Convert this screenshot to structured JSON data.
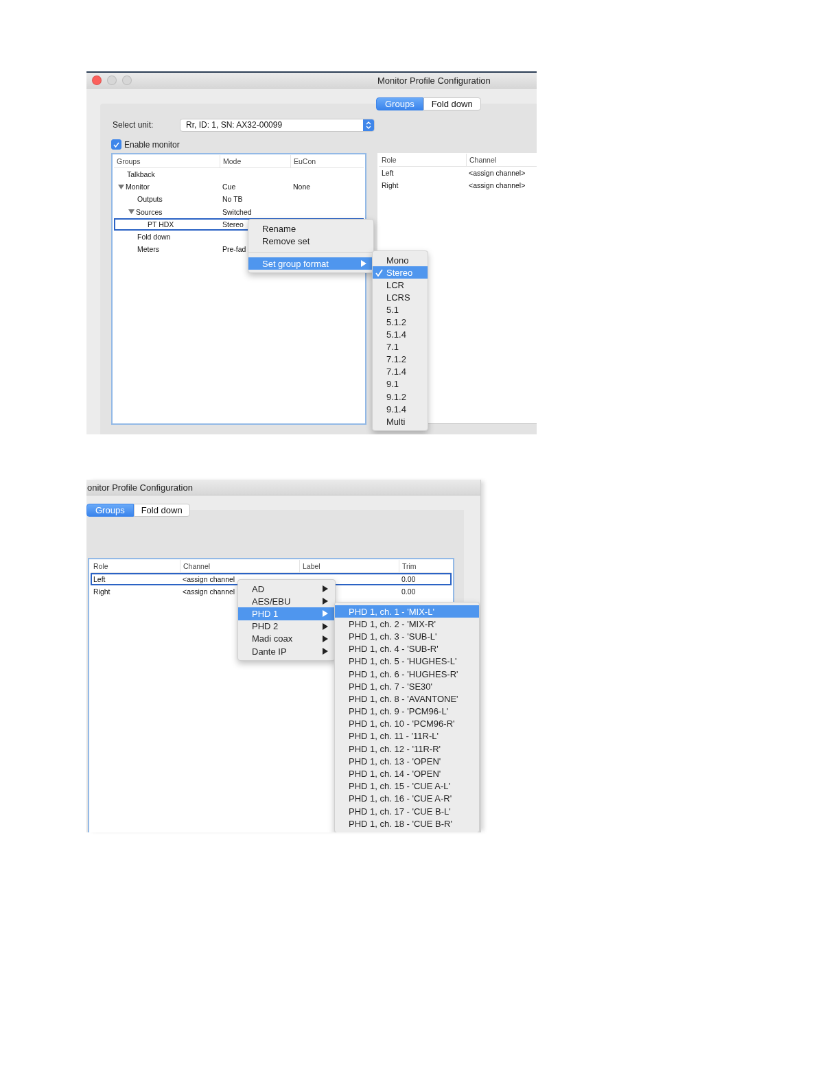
{
  "window_1": {
    "title": "Monitor Profile Configuration",
    "tabs": [
      {
        "label": "Groups",
        "selected": true
      },
      {
        "label": "Fold down",
        "selected": false
      }
    ],
    "select_unit": {
      "label": "Select unit:",
      "value": "Rr, ID: 1, SN: AX32-00099"
    },
    "enable_monitor": {
      "label": "Enable monitor",
      "checked": true
    },
    "groups_table": {
      "columns": [
        "Groups",
        "Mode",
        "EuCon"
      ],
      "rows": [
        {
          "name": "Talkback",
          "selected": false
        },
        {
          "name": "Monitor",
          "mode": "Cue",
          "eucon": "None",
          "expanded": true,
          "selected": false,
          "children": [
            {
              "name": "Outputs",
              "mode": "No TB",
              "selected": false
            },
            {
              "name": "Sources",
              "mode": "Switched",
              "expanded": true,
              "selected": false,
              "children": [
                {
                  "name": "PT HDX",
                  "mode": "Stereo",
                  "selected": true
                }
              ]
            },
            {
              "name": "Fold down",
              "selected": false
            },
            {
              "name": "Meters",
              "mode": "Pre-fad",
              "selected": false
            }
          ]
        }
      ]
    },
    "roles_table": {
      "columns": [
        "Role",
        "Channel"
      ],
      "rows": [
        {
          "role": "Left",
          "channel": "<assign channel>"
        },
        {
          "role": "Right",
          "channel": "<assign channel>"
        }
      ]
    },
    "context_menu": {
      "items": [
        {
          "kind": "item",
          "label": "Rename",
          "highlighted": false,
          "submenu": false
        },
        {
          "kind": "item",
          "label": "Remove set",
          "highlighted": false,
          "submenu": false
        },
        {
          "kind": "separator"
        },
        {
          "kind": "item",
          "label": "Set group format",
          "highlighted": true,
          "submenu": true
        }
      ]
    },
    "format_menu": {
      "items": [
        {
          "label": "Mono",
          "selected": false
        },
        {
          "label": "Stereo",
          "selected": true
        },
        {
          "label": "LCR",
          "selected": false
        },
        {
          "label": "LCRS",
          "selected": false
        },
        {
          "label": "5.1",
          "selected": false
        },
        {
          "label": "5.1.2",
          "selected": false
        },
        {
          "label": "5.1.4",
          "selected": false
        },
        {
          "label": "7.1",
          "selected": false
        },
        {
          "label": "7.1.2",
          "selected": false
        },
        {
          "label": "7.1.4",
          "selected": false
        },
        {
          "label": "9.1",
          "selected": false
        },
        {
          "label": "9.1.2",
          "selected": false
        },
        {
          "label": "9.1.4",
          "selected": false
        },
        {
          "label": "Multi",
          "selected": false
        }
      ]
    }
  },
  "window_2": {
    "title": "onitor Profile Configuration",
    "tabs": [
      {
        "label": "Groups",
        "selected": true
      },
      {
        "label": "Fold down",
        "selected": false
      }
    ],
    "channel_table": {
      "columns": [
        "Role",
        "Channel",
        "Label",
        "Trim"
      ],
      "rows": [
        {
          "role": "Left",
          "channel": "<assign channel",
          "trim": "0.00",
          "selected": true
        },
        {
          "role": "Right",
          "channel": "<assign channel",
          "trim": "0.00",
          "selected": false
        }
      ]
    },
    "source_menu": {
      "items": [
        {
          "label": "AD",
          "highlighted": false,
          "submenu": true
        },
        {
          "label": "AES/EBU",
          "highlighted": false,
          "submenu": true
        },
        {
          "label": "PHD 1",
          "highlighted": true,
          "submenu": true
        },
        {
          "label": "PHD 2",
          "highlighted": false,
          "submenu": true
        },
        {
          "label": "Madi coax",
          "highlighted": false,
          "submenu": true
        },
        {
          "label": "Dante IP",
          "highlighted": false,
          "submenu": true
        }
      ]
    },
    "channel_menu": {
      "items": [
        {
          "label": "PHD 1, ch. 1 - 'MIX-L'",
          "highlighted": true
        },
        {
          "label": "PHD 1, ch. 2 - 'MIX-R'",
          "highlighted": false
        },
        {
          "label": "PHD 1, ch. 3 - 'SUB-L'",
          "highlighted": false
        },
        {
          "label": "PHD 1, ch. 4 - 'SUB-R'",
          "highlighted": false
        },
        {
          "label": "PHD 1, ch. 5 - 'HUGHES-L'",
          "highlighted": false
        },
        {
          "label": "PHD 1, ch. 6 - 'HUGHES-R'",
          "highlighted": false
        },
        {
          "label": "PHD 1, ch. 7 - 'SE30'",
          "highlighted": false
        },
        {
          "label": "PHD 1, ch. 8 - 'AVANTONE'",
          "highlighted": false
        },
        {
          "label": "PHD 1, ch. 9 - 'PCM96-L'",
          "highlighted": false
        },
        {
          "label": "PHD 1, ch. 10 - 'PCM96-R'",
          "highlighted": false
        },
        {
          "label": "PHD 1, ch. 11 - '11R-L'",
          "highlighted": false
        },
        {
          "label": "PHD 1, ch. 12 - '11R-R'",
          "highlighted": false
        },
        {
          "label": "PHD 1, ch. 13 - 'OPEN'",
          "highlighted": false
        },
        {
          "label": "PHD 1, ch. 14 - 'OPEN'",
          "highlighted": false
        },
        {
          "label": "PHD 1, ch. 15 - 'CUE A-L'",
          "highlighted": false
        },
        {
          "label": "PHD 1, ch. 16 - 'CUE A-R'",
          "highlighted": false
        },
        {
          "label": "PHD 1, ch. 17 - 'CUE B-L'",
          "highlighted": false
        },
        {
          "label": "PHD 1, ch. 18 - 'CUE B-R'",
          "highlighted": false
        }
      ]
    }
  }
}
